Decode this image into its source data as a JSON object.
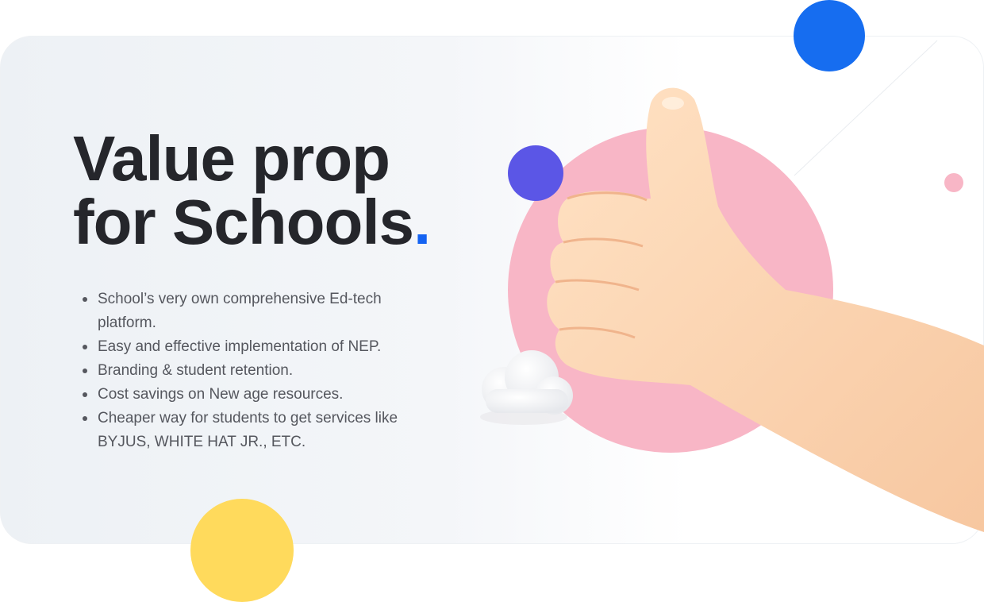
{
  "heading": {
    "line1": "Value prop",
    "line2": "for Schools",
    "dot": "."
  },
  "bullets": [
    "School’s very own comprehensive Ed-tech platform.",
    "Easy and effective implementation of NEP.",
    "Branding & student retention.",
    "Cost savings on New age resources.",
    "Cheaper way for students to get services like BYJUS, WHITE HAT JR., ETC."
  ],
  "colors": {
    "accent_blue": "#1463f2",
    "circle_blue": "#166df0",
    "circle_purple": "#5b56e6",
    "circle_pink": "#f8b6c6",
    "circle_yellow": "#ffda5c",
    "heading_text": "#25262b",
    "body_text": "#55575e"
  },
  "illustration": {
    "hand": "thumbs-up-hand-icon",
    "cloud": "cloud-icon"
  }
}
